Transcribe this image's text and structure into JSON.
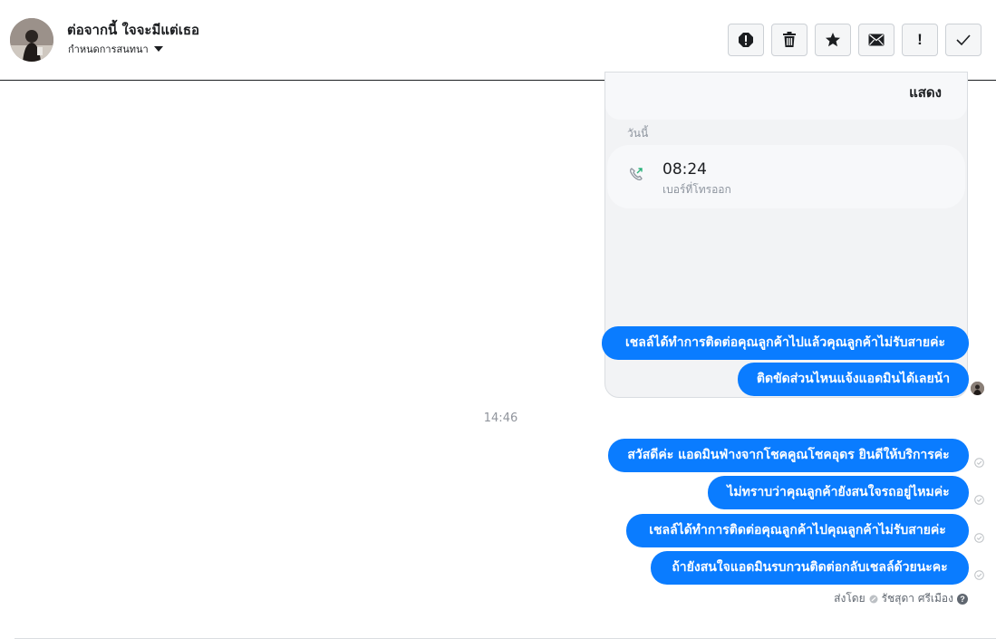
{
  "header": {
    "conversation_name": "ต่อจากนี้ ใจจะมีแต่เธอ",
    "subtitle": "กำหนดการสนทนา",
    "toolbar": [
      {
        "name": "report-icon",
        "label": ""
      },
      {
        "name": "trash-icon",
        "label": ""
      },
      {
        "name": "star-icon",
        "label": ""
      },
      {
        "name": "envelope-icon",
        "label": ""
      },
      {
        "name": "important-icon",
        "label": "!"
      },
      {
        "name": "check-icon",
        "label": ""
      }
    ]
  },
  "call_card": {
    "show_label": "แสดง",
    "day_label": "วันนี้",
    "call_time": "08:24",
    "call_type": "เบอร์ที่โทรออก",
    "call_icon": "outgoing-call-icon"
  },
  "messages": [
    {
      "text": "เชลล์ได้ทำการติดต่อคุณลูกค้าไปแล้วคุณลูกค้าไม่รับสายค่ะ"
    },
    {
      "text": "ติดขัดส่วนไหนแจ้งแอดมินได้เลยน้า"
    },
    {
      "text": "สวัสดีค่ะ แอดมินฟ่างจากโชคคูณโชคอุดร ยินดีให้บริการค่ะ"
    },
    {
      "text": "ไม่ทราบว่าคุณลูกค้ายังสนใจรถอยู่ไหมค่ะ"
    },
    {
      "text": "เชลล์ได้ทำการติดต่อคุณลูกค้าไปคุณลูกค้าไม่รับสายค่ะ"
    },
    {
      "text": "ถ้ายังสนใจแอดมินรบกวนติดต่อกลับเชลล์ด้วยนะคะ"
    }
  ],
  "time_separator": "14:46",
  "sent_by": {
    "prefix": "ส่งโดย",
    "name": "รัชสุดา ศรีเมือง"
  },
  "colors": {
    "bubble": "#0a7cff",
    "card_bg": "#f2f3f5",
    "muted_text": "#8d949e"
  }
}
